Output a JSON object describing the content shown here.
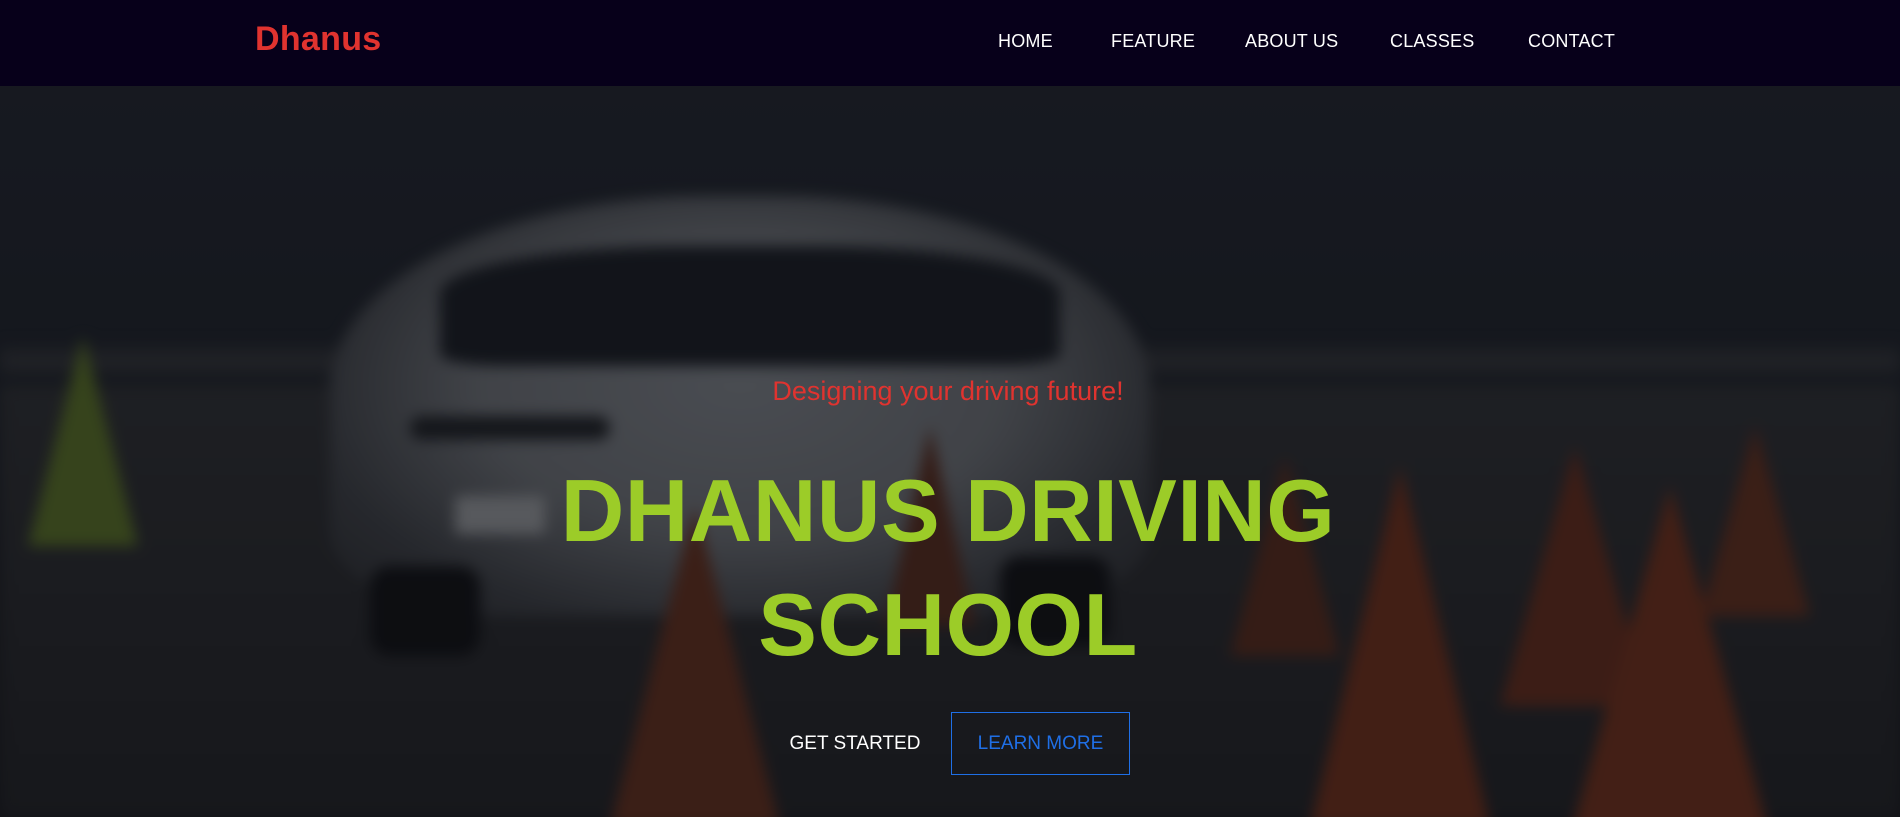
{
  "brand": {
    "name": "Dhanus"
  },
  "nav": {
    "items": [
      {
        "label": "HOME"
      },
      {
        "label": "FEATURE"
      },
      {
        "label": "ABOUT US"
      },
      {
        "label": "CLASSES"
      },
      {
        "label": "CONTACT"
      }
    ]
  },
  "hero": {
    "tagline": "Designing your driving future!",
    "title": "DHANUS DRIVING SCHOOL",
    "buttons": {
      "get_started": "GET STARTED",
      "learn_more": "LEARN MORE"
    },
    "background_image": "blurred white car and traffic cones"
  },
  "colors": {
    "navbar_bg": "#07001a",
    "brand": "#e0332f",
    "tagline": "#e0332f",
    "title": "#9ccc28",
    "learn_more": "#1f6fe6",
    "nav_text": "#ffffff"
  }
}
